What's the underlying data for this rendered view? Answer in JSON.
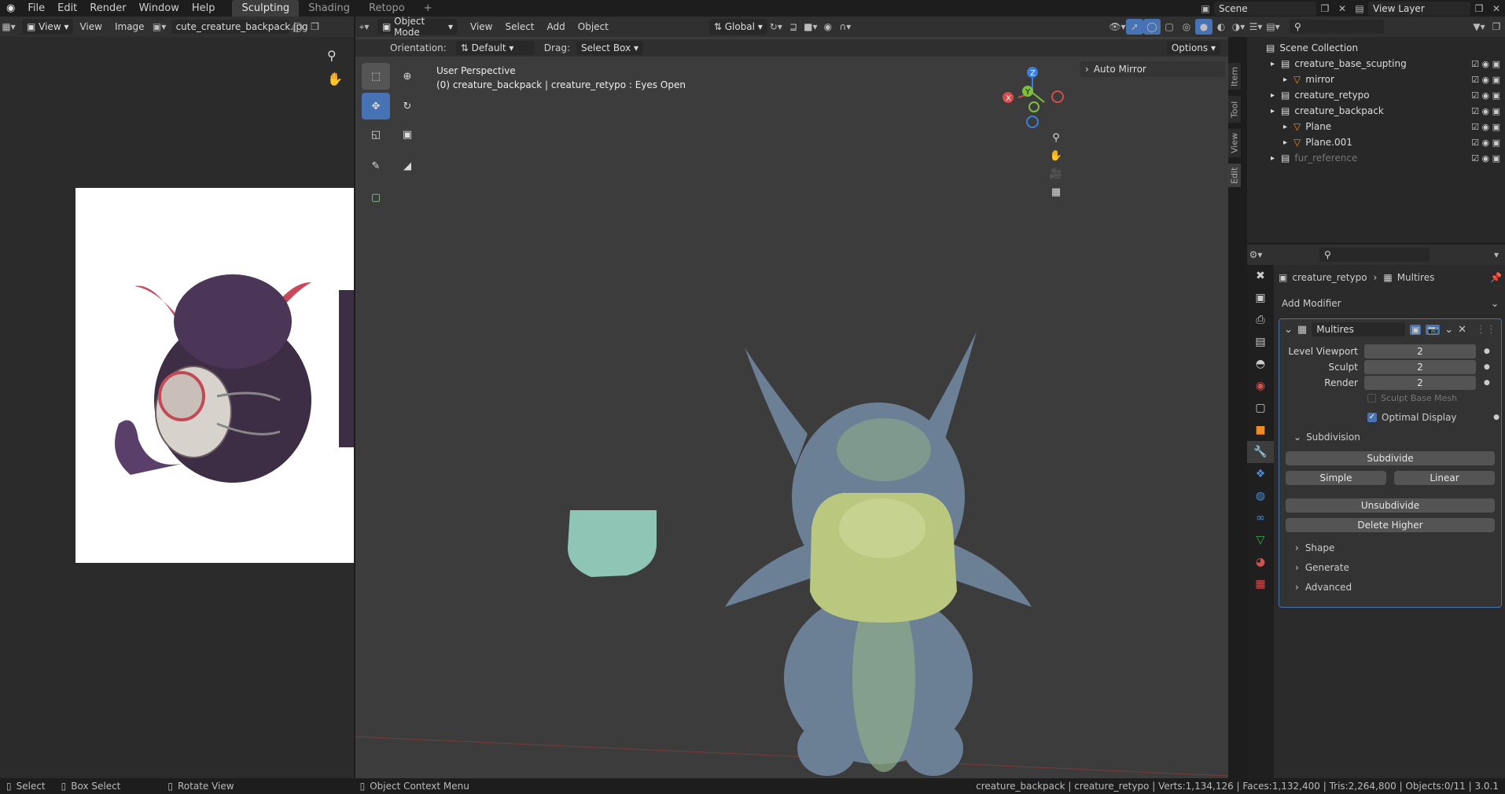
{
  "topbar": {
    "menus": [
      "File",
      "Edit",
      "Render",
      "Window",
      "Help"
    ],
    "workspaces": [
      "Sculpting",
      "Shading",
      "Retopo"
    ],
    "active_workspace": "Sculpting",
    "scene": "Scene",
    "view_layer": "View Layer"
  },
  "image_editor": {
    "view_label": "View",
    "menus": [
      "View",
      "Image"
    ],
    "image_name": "cute_creature_backpack.jpg"
  },
  "viewport": {
    "mode": "Object Mode",
    "menus": [
      "View",
      "Select",
      "Add",
      "Object"
    ],
    "transform_orientation": "Global",
    "orientation_label": "Orientation:",
    "orientation_value": "Default",
    "drag_label": "Drag:",
    "drag_value": "Select Box",
    "options_label": "Options",
    "perspective": "User Perspective",
    "object_info": "(0) creature_backpack | creature_retypo : Eyes Open",
    "auto_mirror": "Auto Mirror",
    "side_tabs": [
      "Item",
      "Tool",
      "View",
      "Edit"
    ],
    "gizmo_axes": [
      "Z",
      "Y",
      "X"
    ]
  },
  "outliner": {
    "title": "Scene Collection",
    "items": [
      {
        "label": "creature_base_scupting",
        "indent": 1
      },
      {
        "label": "mirror",
        "indent": 2
      },
      {
        "label": "creature_retypo",
        "indent": 1
      },
      {
        "label": "creature_backpack",
        "indent": 1
      },
      {
        "label": "Plane",
        "indent": 2
      },
      {
        "label": "Plane.001",
        "indent": 2
      },
      {
        "label": "fur_reference",
        "indent": 1
      }
    ]
  },
  "properties": {
    "breadcrumb_object": "creature_retypo",
    "breadcrumb_modifier": "Multires",
    "add_modifier": "Add Modifier",
    "modifier_name": "Multires",
    "level_viewport_label": "Level Viewport",
    "level_viewport": "2",
    "sculpt_label": "Sculpt",
    "sculpt": "2",
    "render_label": "Render",
    "render": "2",
    "sculpt_base_mesh": "Sculpt Base Mesh",
    "optimal_display": "Optimal Display",
    "subdivision": "Subdivision",
    "subdivide": "Subdivide",
    "simple": "Simple",
    "linear": "Linear",
    "unsubdivide": "Unsubdivide",
    "delete_higher": "Delete Higher",
    "shape": "Shape",
    "generate": "Generate",
    "advanced": "Advanced"
  },
  "status": {
    "select": "Select",
    "box_select": "Box Select",
    "rotate_view": "Rotate View",
    "context_menu": "Object Context Menu",
    "stats": "creature_backpack | creature_retypo | Verts:1,134,126 | Faces:1,132,400 | Tris:2,264,800 | Objects:0/11 | 3.0.1"
  },
  "colors": {
    "accent": "#4772b3",
    "viewport_bg": "#3c3c3c",
    "creature_body": "#6b7f95",
    "backpack": "#b9c77f",
    "plane": "#8ec5b5"
  }
}
